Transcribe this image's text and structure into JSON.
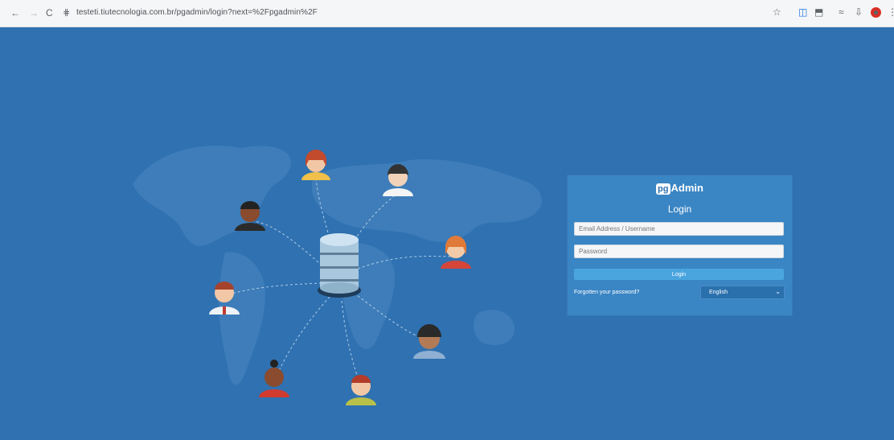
{
  "browser": {
    "back_icon": "←",
    "forward_icon": "→",
    "reload_icon": "C",
    "url": "testeti.tiutecnologia.com.br/pgadmin/login?next=%2Fpgadmin%2F",
    "icons": [
      "star-icon",
      "extension-icon",
      "window-icon",
      "history-icon",
      "download-icon",
      "profile-icon",
      "menu-icon"
    ]
  },
  "login": {
    "brand_prefix": "pg",
    "brand_suffix": "Admin",
    "title": "Login",
    "email_placeholder": "Email Address / Username",
    "password_placeholder": "Password",
    "button_label": "Login",
    "forgot_label": "Forgotten your password?",
    "language": "English"
  },
  "colors": {
    "background": "#2f71b1",
    "card": "#3a85c4",
    "button": "#4aa5df"
  }
}
